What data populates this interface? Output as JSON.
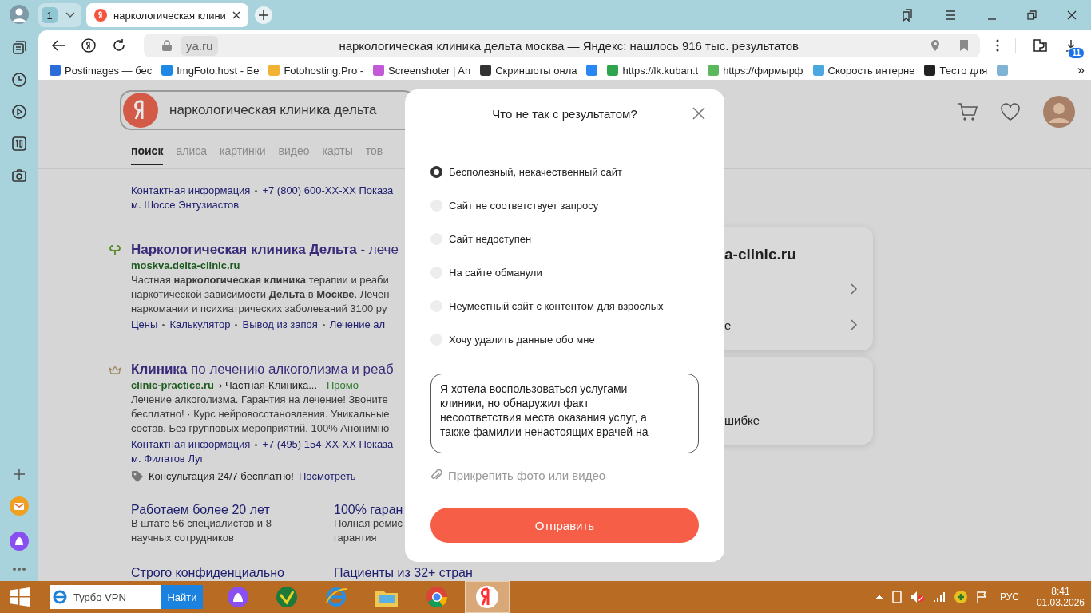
{
  "browser": {
    "tab_group": "1",
    "tab": {
      "title": "наркологическая клини",
      "selected": true
    },
    "address": {
      "domain": "ya.ru",
      "title": "наркологическая клиника дельта москва — Яндекс: нашлось 916 тыс. результатов"
    },
    "downloads_badge": "11",
    "bookmarks": [
      {
        "label": "Postimages — бес",
        "color": "#2b6cd8"
      },
      {
        "label": "ImgFoto.host - Бе",
        "color": "#1e88e5"
      },
      {
        "label": "Fotohosting.Pro -",
        "color": "#f2b233"
      },
      {
        "label": "Screenshoter | An",
        "color": "#c259d6"
      },
      {
        "label": "Скриншоты онла",
        "color": "#333333"
      },
      {
        "color": "#2787f5"
      },
      {
        "label": "https://lk.kuban.t",
        "color": "#2ea44f"
      },
      {
        "label": "https://фирмырф",
        "color": "#5cb85c"
      },
      {
        "label": "Скорость интерне",
        "color": "#4aa8e0"
      },
      {
        "label": "Тесто для",
        "color": "#222222"
      },
      {
        "color": "#7fb3d5"
      }
    ],
    "bookmarks_more": "»"
  },
  "search": {
    "query": "наркологическая клиника дельта",
    "tabs": [
      {
        "label": "поиск",
        "selected": true
      },
      {
        "label": "алиса",
        "selected": false
      },
      {
        "label": "картинки",
        "selected": false
      },
      {
        "label": "видео",
        "selected": false
      },
      {
        "label": "карты",
        "selected": false
      },
      {
        "label": "тов",
        "selected": false
      }
    ]
  },
  "results": [
    {
      "kind": "partial",
      "contacts": "Контактная информация",
      "phone": "+7 (800) 600-XX-XX Показа",
      "address": "м. Шоссе Энтузиастов"
    },
    {
      "kind": "organic",
      "title": "**Наркологическая клиника Дельта** - лече",
      "url": "moskva.delta-clinic.ru",
      "snippet": [
        "Частная **наркологическая клиника** терапии и реаби",
        "наркотической зависимости **Дельта** в **Москве**. Лечен",
        "наркомании и психиатрических заболеваний 3100 ру"
      ],
      "links": [
        "Цены",
        "Калькулятор",
        "Вывод из запоя",
        "Лечение ал"
      ]
    },
    {
      "kind": "ad",
      "title": "**Клиника** по лечению алкоголизма и реаб",
      "url": "clinic-practice.ru",
      "breadcrumb": "› Частная-Клиника...",
      "label": "Промо",
      "snippet": [
        "Лечение алкоголизма. Гарантия на лечение! Звоните",
        "бесплатно! · Курс нейровосстановления. Уникальные",
        "состав. Без групповых мероприятий. 100% Анонимно"
      ],
      "contacts": "Контактная информация",
      "phone": "+7 (495) 154-XX-XX Показа",
      "address": "м. Филатов Луг",
      "offer": "Консультация 24/7 бесплатно!",
      "offer_link": "Посмотреть",
      "features": [
        {
          "title": "Работаем более 20 лет",
          "lines": [
            "В штате 56 специалистов и 8",
            "научных сотрудников"
          ]
        },
        {
          "title": "100% гаран",
          "lines": [
            "Полная ремис",
            "гарантия"
          ]
        },
        {
          "title": "Строго конфиденциально"
        },
        {
          "title": "Пациенты из 32+ стран"
        }
      ]
    }
  ],
  "side_panel": {
    "title": "a-clinic.ru",
    "rows": [
      {
        "kind": "link"
      },
      {
        "kind": "link",
        "label": "e"
      }
    ],
    "second_card": "шибке"
  },
  "dialog": {
    "title": "Что не так с результатом?",
    "options": [
      {
        "label": "Бесполезный, некачественный сайт",
        "selected": true
      },
      {
        "label": "Сайт не соответствует запросу",
        "selected": false
      },
      {
        "label": "Сайт недоступен",
        "selected": false
      },
      {
        "label": "На сайте обманули",
        "selected": false
      },
      {
        "label": "Неуместный сайт с контентом для взрослых",
        "selected": false
      },
      {
        "label": "Хочу удалить данные обо мне",
        "selected": false
      }
    ],
    "comment": "Я хотела воспользоваться услугами клиники, но обнаружил факт несоответствия места оказания услуг, а также фамилии ненастоящих врачей на",
    "attach": "Прикрепить фото или видео",
    "submit": "Отправить"
  },
  "taskbar": {
    "search_value": "Турбо VPN",
    "search_button": "Найти",
    "language": "РУС",
    "time": "8:41",
    "date": "01.03.2026"
  }
}
